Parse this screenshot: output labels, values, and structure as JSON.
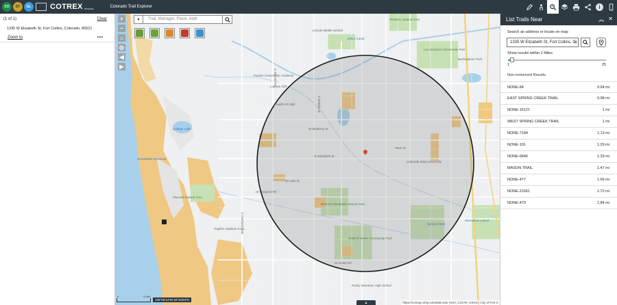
{
  "header": {
    "logos": [
      "CO",
      "ST",
      "GL"
    ],
    "app_name": "COTREX",
    "app_tag": "desktop",
    "app_subtitle": "Colorado Trail Explorer"
  },
  "toolbar": {
    "buttons": [
      "draw-icon",
      "street-view-icon",
      "list-trails-near-icon",
      "layers-icon",
      "print-icon",
      "share-icon",
      "info-icon",
      "mobile-icon"
    ],
    "info_glyph": "i"
  },
  "left_panel": {
    "result_count": "(1 of 1)",
    "clear_label": "Clear",
    "address": "1335 W Elizabeth St, Fort Collins, Colorado, 80521",
    "zoom_label": "Zoom to",
    "more_label": "•••"
  },
  "map": {
    "search_placeholder": "Trail, Manager, Place, Addr",
    "dropdown_glyph": "▼",
    "zoom_in": "+",
    "zoom_out": "−",
    "nav_glyphs": [
      "⌂",
      "◎",
      "◀",
      "▶"
    ],
    "layer_colors": [
      "#6a9c3a",
      "#6aa430",
      "#d98b2a",
      "#c43b2b",
      "#3b8fd1"
    ],
    "labels": {
      "lincoln_middle": "Lincoln Middle School",
      "arthur_canal": "Arthur Canal",
      "mcmurry": "McMurry Natural Area",
      "poudre_community": "Poudre Community Academy",
      "laporte_ave": "Laporte Ave",
      "poudre_high": "Poudre St High",
      "lee_martinez": "Lee Martinez Community Park",
      "buckingham": "Buckingham Park",
      "college_lake": "College Lake",
      "horsetooth": "Horsetooth Reservoir",
      "maxwell": "Maxwell Natural Area",
      "hughes": "Hughes Stadium-CSU",
      "w_elizabeth": "W Elizabeth St",
      "csu": "Colorado State University",
      "w_prospect": "W Prospect Rd",
      "red_fox": "Red Fox Meadows Natural Area",
      "rolland_moore": "Rolland Moore Community Park",
      "w_drake": "W Drake Rd",
      "spring_creek": "Spring Creek",
      "rocky_mountain": "Rocky Mountain High School",
      "sherwood": "Sherwood Lateral",
      "mulberry": "W Mulberry St",
      "plum": "Plum St",
      "lake": "W Lake St",
      "shields": "S Shields St",
      "taft": "S Taft Hill Rd",
      "overland": "S Overland Trail"
    },
    "scale_labels": [
      "0",
      "0.4mi"
    ],
    "coordinates": "105°05'14\"W 40°34'53\"N",
    "collapse_glyph": "▲",
    "attribution": "https://comap.cnhp.colostate.edu | Esri, CGIAR, USGS | City of Fort C"
  },
  "right_panel": {
    "title": "List Trails Near",
    "collapse_glyph": "︽",
    "close_glyph": "✕",
    "search_label": "Search an address or locate on map",
    "search_value": "1335 W Elizabeth St, Fort Collins, C",
    "within_label": "Show results within 2 Miles",
    "slider_min": "1",
    "slider_max": "25",
    "slider_value": 2,
    "slider_range": [
      1,
      25
    ],
    "section_title": "Non-motorized Results",
    "trails": [
      {
        "name": "NONE-84",
        "distance": "0.94 mi"
      },
      {
        "name": "EAST SPRING CREEK TRAIL",
        "distance": "0.98 mi"
      },
      {
        "name": "NONE-16121",
        "distance": "1 mi"
      },
      {
        "name": "WEST SPRING CREEK TRAIL",
        "distance": "1 mi"
      },
      {
        "name": "NONE-7184",
        "distance": "1.13 mi"
      },
      {
        "name": "NONE-101",
        "distance": "1.29 mi"
      },
      {
        "name": "NONE-6846",
        "distance": "1.33 mi"
      },
      {
        "name": "MASON TRAIL",
        "distance": "1.47 mi"
      },
      {
        "name": "NONE-477",
        "distance": "1.66 mi"
      },
      {
        "name": "NONE-21561",
        "distance": "1.72 mi"
      },
      {
        "name": "NONE-479",
        "distance": "1.84 mi"
      }
    ]
  },
  "colors": {
    "header_bg": "#2e3a42",
    "water": "#a8d0ea",
    "park": "#c7e1b4",
    "terrain": "#efc884",
    "accent": "#2e7ed0"
  }
}
